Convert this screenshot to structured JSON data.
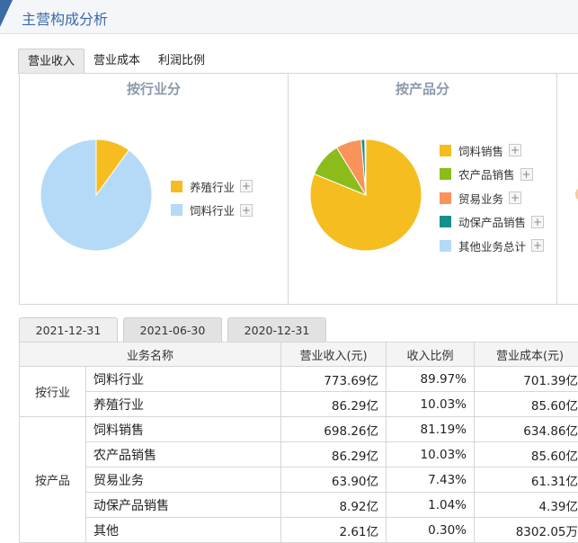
{
  "header": {
    "title": "主营构成分析"
  },
  "tabs": [
    {
      "label": "营业收入",
      "active": true
    },
    {
      "label": "营业成本",
      "active": false
    },
    {
      "label": "利润比例",
      "active": false
    }
  ],
  "colors": {
    "yellow": "#f5bd1f",
    "lightblue": "#b4daf7",
    "green": "#8cbc1b",
    "orange": "#f8945a",
    "teal": "#168e8c",
    "title_blue": "#3b6aa7"
  },
  "industry_chart": {
    "title": "按行业分",
    "legend": [
      {
        "label": "养殖行业",
        "color": "#f5bd1f"
      },
      {
        "label": "饲料行业",
        "color": "#b4daf7"
      }
    ]
  },
  "product_chart": {
    "title": "按产品分",
    "legend": [
      {
        "label": "饲料销售",
        "color": "#f5bd1f"
      },
      {
        "label": "农产品销售",
        "color": "#8cbc1b"
      },
      {
        "label": "贸易业务",
        "color": "#f8945a"
      },
      {
        "label": "动保产品销售",
        "color": "#168e8c"
      },
      {
        "label": "其他业务总计",
        "color": "#b4daf7"
      }
    ]
  },
  "chart_data": [
    {
      "type": "pie",
      "title": "按行业分",
      "categories": [
        "养殖行业",
        "饲料行业"
      ],
      "values": [
        10.03,
        89.97
      ],
      "colors": [
        "#f5bd1f",
        "#b4daf7"
      ],
      "start": "12 o'clock, clockwise",
      "legend": "right"
    },
    {
      "type": "pie",
      "title": "按产品分",
      "categories": [
        "饲料销售",
        "农产品销售",
        "贸易业务",
        "动保产品销售",
        "其他业务总计"
      ],
      "values": [
        81.19,
        10.03,
        7.43,
        1.04,
        0.3
      ],
      "colors": [
        "#f5bd1f",
        "#8cbc1b",
        "#f8945a",
        "#168e8c",
        "#b4daf7"
      ],
      "start": "12 o'clock, clockwise",
      "legend": "right"
    }
  ],
  "date_tabs": [
    {
      "label": "2021-12-31",
      "active": true
    },
    {
      "label": "2021-06-30",
      "active": false
    },
    {
      "label": "2020-12-31",
      "active": false
    }
  ],
  "table": {
    "headers": {
      "name": "业务名称",
      "revenue": "营业收入(元)",
      "ratio": "收入比例",
      "cost": "营业成本(元)"
    },
    "groups": [
      {
        "label": "按行业",
        "rows": [
          {
            "name": "饲料行业",
            "revenue": "773.69亿",
            "ratio": "89.97%",
            "cost": "701.39亿"
          },
          {
            "name": "养殖行业",
            "revenue": "86.29亿",
            "ratio": "10.03%",
            "cost": "85.60亿"
          }
        ]
      },
      {
        "label": "按产品",
        "rows": [
          {
            "name": "饲料销售",
            "revenue": "698.26亿",
            "ratio": "81.19%",
            "cost": "634.86亿"
          },
          {
            "name": "农产品销售",
            "revenue": "86.29亿",
            "ratio": "10.03%",
            "cost": "85.60亿"
          },
          {
            "name": "贸易业务",
            "revenue": "63.90亿",
            "ratio": "7.43%",
            "cost": "61.31亿"
          },
          {
            "name": "动保产品销售",
            "revenue": "8.92亿",
            "ratio": "1.04%",
            "cost": "4.39亿"
          },
          {
            "name": "其他",
            "revenue": "2.61亿",
            "ratio": "0.30%",
            "cost": "8302.05万"
          }
        ]
      }
    ]
  }
}
